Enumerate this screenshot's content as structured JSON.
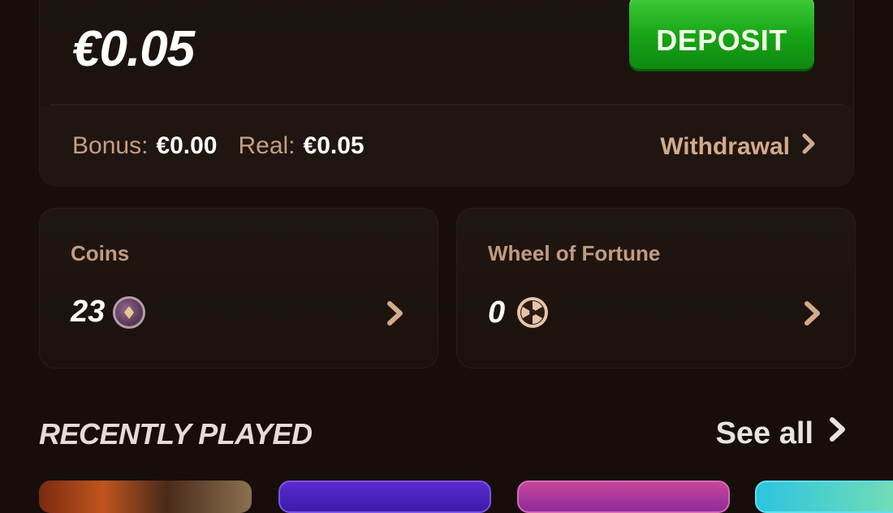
{
  "balance": {
    "amount": "€0.05",
    "deposit_label": "DEPOSIT",
    "bonus_label": "Bonus:",
    "bonus_value": "€0.00",
    "real_label": "Real:",
    "real_value": "€0.05",
    "withdrawal_label": "Withdrawal"
  },
  "tiles": {
    "coins": {
      "title": "Coins",
      "value": "23",
      "icon": "coin-icon"
    },
    "wheel": {
      "title": "Wheel of Fortune",
      "value": "0",
      "icon": "wheel-icon"
    }
  },
  "recently_played": {
    "title": "RECENTLY PLAYED",
    "see_all_label": "See all"
  },
  "colors": {
    "background": "#170e0b",
    "card": "#1d1410",
    "accent_label": "#c79e83",
    "deposit_green": "#17a317"
  }
}
